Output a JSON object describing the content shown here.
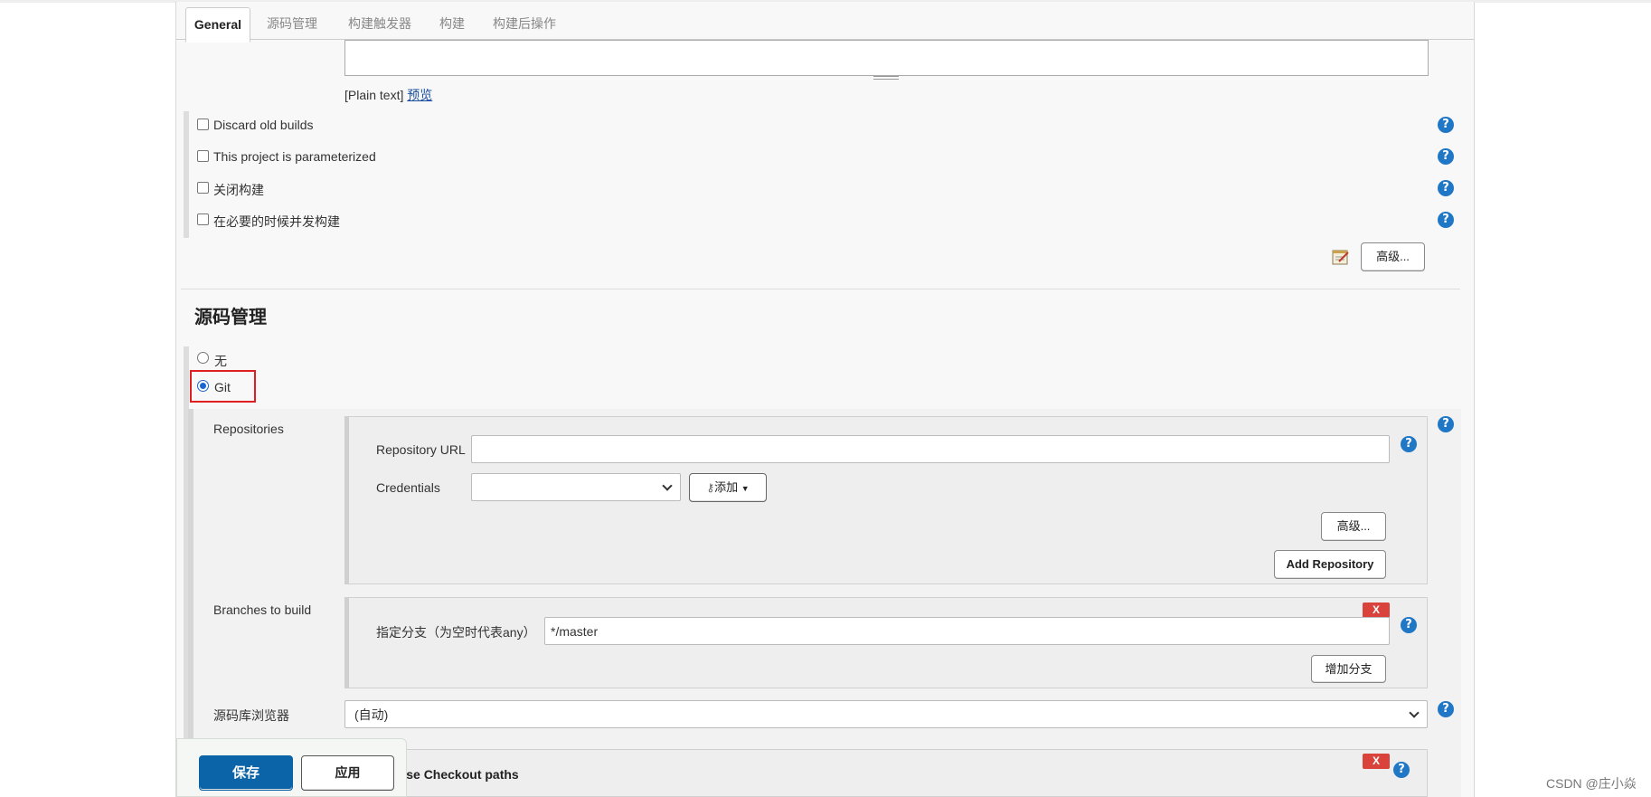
{
  "tabs": [
    {
      "label": "General"
    },
    {
      "label": "源码管理"
    },
    {
      "label": "构建触发器"
    },
    {
      "label": "构建"
    },
    {
      "label": "构建后操作"
    }
  ],
  "description": {
    "format": "[Plain text]",
    "preview": "预览"
  },
  "general_options": [
    {
      "label": "Discard old builds"
    },
    {
      "label": "This project is parameterized"
    },
    {
      "label": "关闭构建"
    },
    {
      "label": "在必要的时候并发构建"
    }
  ],
  "advanced_label": "高级...",
  "scm": {
    "title": "源码管理",
    "none_label": "无",
    "git_label": "Git",
    "repositories_label": "Repositories",
    "repo_url_label": "Repository URL",
    "repo_url_value": "",
    "credentials_label": "Credentials",
    "credentials_value": "",
    "add_label": "添加",
    "advanced_label": "高级...",
    "add_repository_label": "Add Repository",
    "branches_label": "Branches to build",
    "branch_spec_label": "指定分支（为空时代表any）",
    "branch_spec_value": "*/master",
    "add_branch_label": "增加分支",
    "browser_label": "源码库浏览器",
    "browser_value": "(自动)",
    "sparse_label_visible": "arse Checkout paths",
    "x_label": "X"
  },
  "footer": {
    "save": "保存",
    "apply": "应用"
  },
  "watermark": "CSDN @庄小焱",
  "help_glyph": "?",
  "colors": {
    "primary": "#0b64a8",
    "help": "#1f77c6",
    "delete": "#d9433b",
    "highlight": "#e02020"
  }
}
